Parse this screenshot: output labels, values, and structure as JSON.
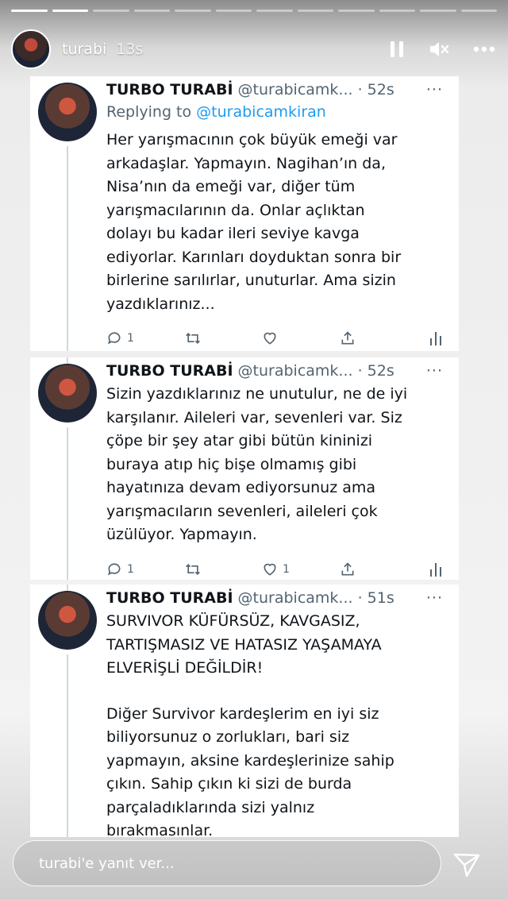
{
  "story": {
    "username": "turabi",
    "time_ago": "13s",
    "reply_placeholder": "turabi'e yanıt ver..."
  },
  "tweets": [
    {
      "display_name": "TURBO TURABİ",
      "handle": "@turabicamk...",
      "time": "· 52s",
      "more": "···",
      "replying_label": "Replying to",
      "replying_to": "@turabicamkiran",
      "lines": [
        "Her yarışmacının çok büyük emeği var",
        "arkadaşlar. Yapmayın. Nagihan’ın da,",
        "Nisa’nın da emeği var, diğer tüm",
        "yarışmacılarının da. Onlar açlıktan",
        "dolayı bu kadar ileri seviye kavga",
        "ediyorlar. Karınları doyduktan sonra bir",
        "birlerine sarılırlar, unuturlar. Ama sizin",
        "yazdıklarınız..."
      ],
      "reply_count": "1",
      "retweet_count": "",
      "like_count": ""
    },
    {
      "display_name": "TURBO TURABİ",
      "handle": "@turabicamk...",
      "time": "· 52s",
      "more": "···",
      "lines": [
        "Sizin yazdıklarınız ne unutulur, ne de iyi",
        "karşılanır. Aileleri var, sevenleri var. Siz",
        "çöpe bir şey atar gibi bütün kininizi",
        "buraya atıp hiç bişe olmamış gibi",
        "hayatınıza devam ediyorsunuz ama",
        "yarışmacıların sevenleri, aileleri çok",
        "üzülüyor. Yapmayın."
      ],
      "reply_count": "1",
      "retweet_count": "",
      "like_count": "1"
    },
    {
      "display_name": "TURBO TURABİ",
      "handle": "@turabicamk...",
      "time": "· 51s",
      "more": "···",
      "lines": [
        "SURVIVOR KÜFÜRSÜZ, KAVGASIZ,",
        "TARTIŞMASIZ VE HATASIZ YAŞAMAYA",
        "ELVERİŞLİ DEĞİLDİR!"
      ],
      "lines2": [
        "Diğer Survivor kardeşlerim en iyi siz",
        "biliyorsunuz o zorlukları, bari siz",
        "yapmayın, aksine kardeşlerinize sahip",
        "çıkın. Sahip çıkın ki sizi de burda",
        "parçaladıklarında sizi yalnız",
        "bırakmasınlar."
      ]
    }
  ]
}
